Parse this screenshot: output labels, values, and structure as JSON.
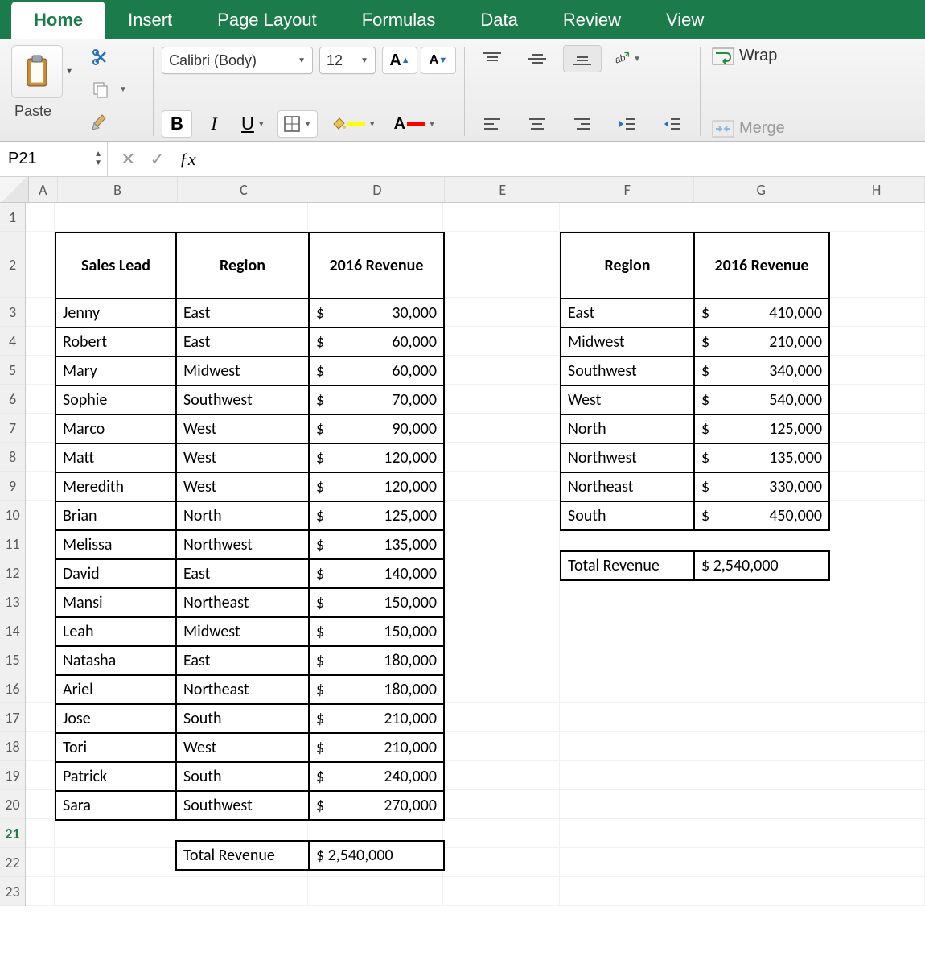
{
  "ribbon": {
    "tabs": [
      "Home",
      "Insert",
      "Page Layout",
      "Formulas",
      "Data",
      "Review",
      "View"
    ],
    "active_tab": "Home",
    "paste_label": "Paste",
    "font_name": "Calibri (Body)",
    "font_size": "12",
    "wrap_label": "Wrap",
    "merge_label": "Merge"
  },
  "formula_bar": {
    "cell_ref": "P21",
    "formula": ""
  },
  "grid": {
    "col_labels": [
      "A",
      "B",
      "C",
      "D",
      "E",
      "F",
      "G",
      "H"
    ],
    "row_labels": [
      "1",
      "2",
      "3",
      "4",
      "5",
      "6",
      "7",
      "8",
      "9",
      "10",
      "11",
      "12",
      "13",
      "14",
      "15",
      "16",
      "17",
      "18",
      "19",
      "20",
      "21",
      "22",
      "23"
    ],
    "selected_row_label": "21"
  },
  "table_left": {
    "headers": [
      "Sales Lead",
      "Region",
      "2016 Revenue"
    ],
    "rows": [
      {
        "lead": "Jenny",
        "region": "East",
        "rev": "30,000"
      },
      {
        "lead": "Robert",
        "region": "East",
        "rev": "60,000"
      },
      {
        "lead": "Mary",
        "region": "Midwest",
        "rev": "60,000"
      },
      {
        "lead": "Sophie",
        "region": "Southwest",
        "rev": "70,000"
      },
      {
        "lead": "Marco",
        "region": "West",
        "rev": "90,000"
      },
      {
        "lead": "Matt",
        "region": "West",
        "rev": "120,000"
      },
      {
        "lead": "Meredith",
        "region": "West",
        "rev": "120,000"
      },
      {
        "lead": "Brian",
        "region": "North",
        "rev": "125,000"
      },
      {
        "lead": "Melissa",
        "region": "Northwest",
        "rev": "135,000"
      },
      {
        "lead": "David",
        "region": "East",
        "rev": "140,000"
      },
      {
        "lead": "Mansi",
        "region": "Northeast",
        "rev": "150,000"
      },
      {
        "lead": "Leah",
        "region": "Midwest",
        "rev": "150,000"
      },
      {
        "lead": "Natasha",
        "region": "East",
        "rev": "180,000"
      },
      {
        "lead": "Ariel",
        "region": "Northeast",
        "rev": "180,000"
      },
      {
        "lead": "Jose",
        "region": "South",
        "rev": "210,000"
      },
      {
        "lead": "Tori",
        "region": "West",
        "rev": "210,000"
      },
      {
        "lead": "Patrick",
        "region": "South",
        "rev": "240,000"
      },
      {
        "lead": "Sara",
        "region": "Southwest",
        "rev": "270,000"
      }
    ],
    "total_label": "Total Revenue",
    "total_value": "$ 2,540,000"
  },
  "table_right": {
    "headers": [
      "Region",
      "2016 Revenue"
    ],
    "rows": [
      {
        "region": "East",
        "rev": "410,000"
      },
      {
        "region": "Midwest",
        "rev": "210,000"
      },
      {
        "region": "Southwest",
        "rev": "340,000"
      },
      {
        "region": "West",
        "rev": "540,000"
      },
      {
        "region": "North",
        "rev": "125,000"
      },
      {
        "region": "Northwest",
        "rev": "135,000"
      },
      {
        "region": "Northeast",
        "rev": "330,000"
      },
      {
        "region": "South",
        "rev": "450,000"
      }
    ],
    "total_label": "Total Revenue",
    "total_value": "$ 2,540,000"
  }
}
